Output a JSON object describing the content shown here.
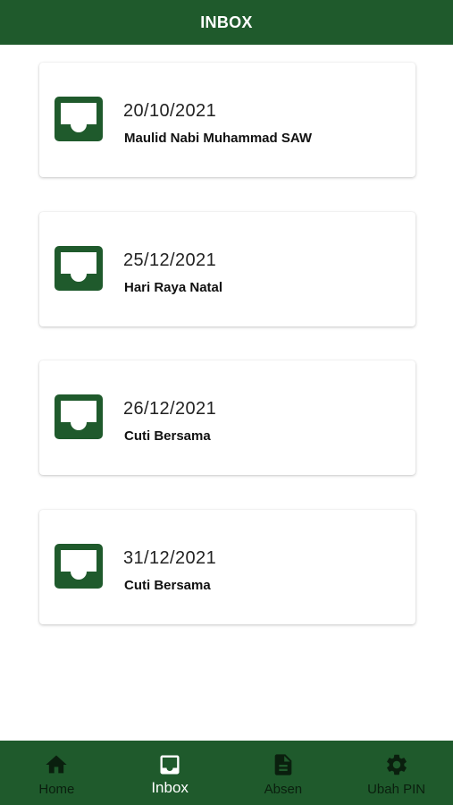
{
  "header": {
    "title": "INBOX"
  },
  "inbox": {
    "items": [
      {
        "date": "20/10/2021",
        "title": "Maulid Nabi Muhammad SAW",
        "icon": "inbox-icon"
      },
      {
        "date": "25/12/2021",
        "title": "Hari Raya Natal",
        "icon": "inbox-icon"
      },
      {
        "date": "26/12/2021",
        "title": "Cuti Bersama",
        "icon": "inbox-icon"
      },
      {
        "date": "31/12/2021",
        "title": "Cuti Bersama",
        "icon": "inbox-icon"
      }
    ]
  },
  "bottom_nav": {
    "active": "Inbox",
    "items": [
      {
        "label": "Home",
        "icon": "home-icon"
      },
      {
        "label": "Inbox",
        "icon": "inbox-icon"
      },
      {
        "label": "Absen",
        "icon": "document-icon"
      },
      {
        "label": "Ubah PIN",
        "icon": "gear-icon"
      }
    ]
  },
  "colors": {
    "primary": "#1f5a2c",
    "nav_inactive_text": "#0a1f0e",
    "nav_active_text": "#ffffff",
    "card_background": "#ffffff"
  }
}
